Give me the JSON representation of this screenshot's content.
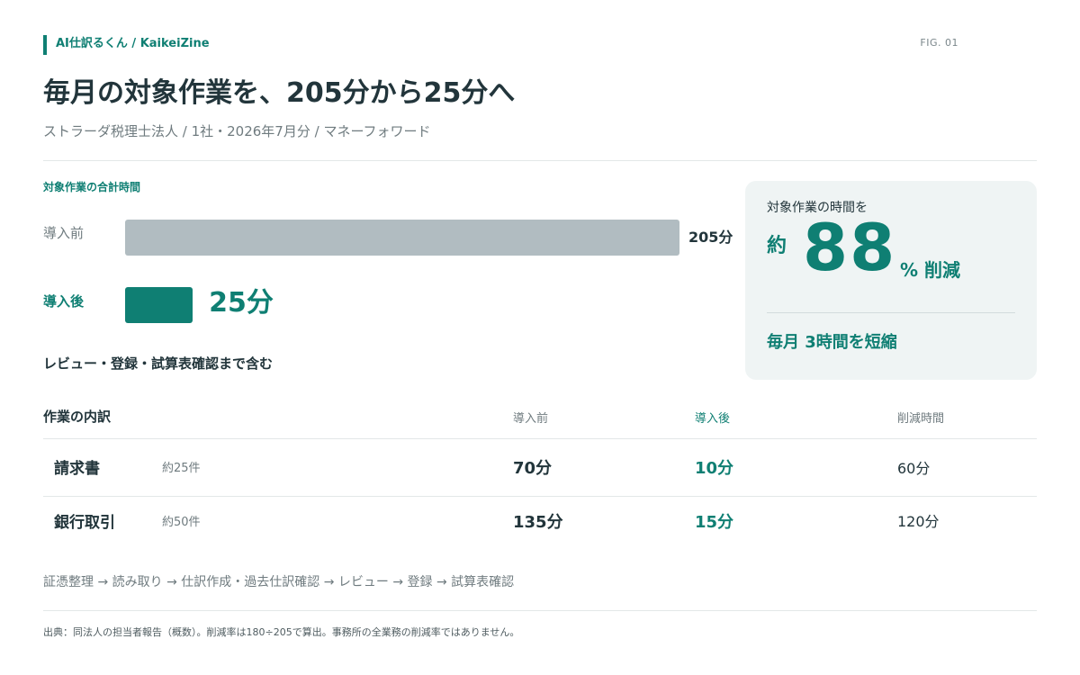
{
  "brand": "AI仕訳るくん / KaikeiZine",
  "fig_label": "FIG. 01",
  "title": "毎月の対象作業を、205分から25分へ",
  "subtitle": "ストラーダ税理士法人 / 1社・2026年7月分 / マネーフォワード",
  "summary": {
    "section_label": "対象作業の合計時間",
    "before_label": "導入前",
    "after_label": "導入後",
    "note": "レビュー・登録・試算表確認まで含む"
  },
  "card": {
    "label": "対象作業の時間を",
    "prefix": "約",
    "value": "88",
    "suffix": "% 削減",
    "bottom": "毎月 3時間を短縮"
  },
  "table": {
    "title": "作業の内訳",
    "headers": {
      "before": "導入前",
      "after": "導入後",
      "saved": "削減時間"
    },
    "rows": [
      {
        "name": "請求書",
        "count": "約25件",
        "before": "70分",
        "after": "10分",
        "saved": "60分"
      },
      {
        "name": "銀行取引",
        "count": "約50件",
        "before": "135分",
        "after": "15分",
        "saved": "120分"
      }
    ]
  },
  "flow": "証憑整理 → 読み取り → 仕訳作成・過去仕訳確認 → レビュー → 登録 → 試算表確認",
  "source": "出典：同法人の担当者報告（概数）。削減率は180÷205で算出。事務所の全業務の削減率ではありません。",
  "chart_data": {
    "type": "bar",
    "orientation": "horizontal",
    "title": "対象作業の合計時間",
    "categories": [
      "導入前",
      "導入後"
    ],
    "values": [
      205,
      25
    ],
    "value_labels": [
      "205分",
      "25分"
    ],
    "xlim": [
      0,
      205
    ],
    "colors": [
      "#b1bcc1",
      "#0f7f73"
    ],
    "grid": false,
    "legend": "none"
  }
}
